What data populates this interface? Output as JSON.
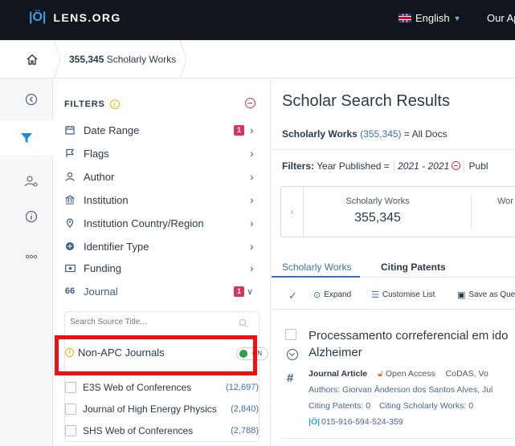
{
  "header": {
    "logo_text": "LENS.ORG",
    "language": "English",
    "our_apps": "Our Ap"
  },
  "breadcrumb": {
    "count": "355,345",
    "label": "Scholarly Works"
  },
  "rail": {
    "icons": [
      "collapse-icon",
      "filter-icon",
      "users-settings-icon",
      "info-icon",
      "more-icon"
    ]
  },
  "filters": {
    "title": "FILTERS",
    "items": [
      {
        "label": "Date Range",
        "icon": "calendar-icon",
        "badge": "1"
      },
      {
        "label": "Flags",
        "icon": "flag-icon",
        "badge": ""
      },
      {
        "label": "Author",
        "icon": "person-icon",
        "badge": ""
      },
      {
        "label": "Institution",
        "icon": "institution-icon",
        "badge": ""
      },
      {
        "label": "Institution Country/Region",
        "icon": "location-icon",
        "badge": ""
      },
      {
        "label": "Identifier Type",
        "icon": "identifier-icon",
        "badge": ""
      },
      {
        "label": "Funding",
        "icon": "funding-icon",
        "badge": ""
      },
      {
        "label": "Journal",
        "icon": "journal-icon",
        "badge": "1"
      }
    ],
    "source_search_placeholder": "Search Source Title...",
    "non_apc_label": "Non-APC Journals",
    "toggle_label": "ON",
    "journals": [
      {
        "name": "E3S Web of Conferences",
        "count": "(12,697)"
      },
      {
        "name": "Journal of High Energy Physics",
        "count": "(2,840)"
      },
      {
        "name": "SHS Web of Conferences",
        "count": "(2,788)"
      }
    ]
  },
  "main": {
    "title": "Scholar Search Results",
    "summary_prefix": "Scholarly Works",
    "summary_count": "(355,345)",
    "summary_suffix": "=  All Docs",
    "filters_label": "Filters:",
    "filter_name": "Year Published =",
    "filter_value": "2021 - 2021",
    "filter_next": "Publ",
    "stat_label": "Scholarly Works",
    "stat_value": "355,345",
    "stat_label2": "Wor",
    "tabs": [
      "Scholarly Works",
      "Citing Patents"
    ],
    "toolbar": {
      "expand": "Expand",
      "customise": "Customise List",
      "save": "Save as Que"
    },
    "result": {
      "title": "Processamento correferencial em ido Alzheimer",
      "type": "Journal Article",
      "access": "Open Access",
      "source": "CoDAS, Vo",
      "authors": "Authors: Giorvan Ânderson dos Santos Alves, Jul",
      "citing_patents": "Citing Patents: 0",
      "citing_works": "Citing Scholarly Works: 0",
      "lens_id": "015-916-594-524-359"
    }
  }
}
